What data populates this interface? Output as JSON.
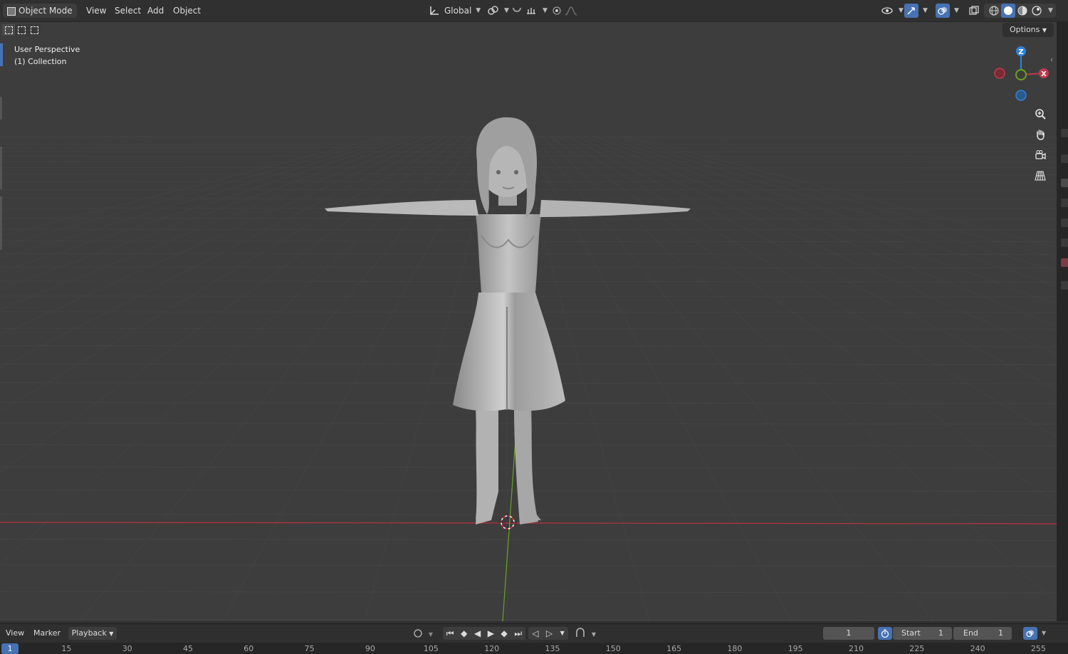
{
  "header": {
    "mode": "Object Mode",
    "menus": [
      "View",
      "Select",
      "Add",
      "Object"
    ],
    "orientation": "Global"
  },
  "viewport": {
    "view_name": "User Perspective",
    "collection": "(1) Collection",
    "options_label": "Options",
    "gizmo": {
      "z": "Z",
      "x": "X"
    }
  },
  "timeline": {
    "menus": [
      "View",
      "Marker"
    ],
    "playback": "Playback",
    "current_frame": "1",
    "start_label": "Start",
    "start_value": "1",
    "end_label": "End",
    "end_value": "1",
    "ruler_current": "1",
    "ruler_ticks": [
      "15",
      "30",
      "45",
      "60",
      "75",
      "90",
      "105",
      "120",
      "135",
      "150",
      "165",
      "180",
      "195",
      "210",
      "225",
      "240",
      "255"
    ]
  },
  "colors": {
    "accent": "#4772b3",
    "axis_x": "#c0394b",
    "axis_y": "#6aa321",
    "axis_z": "#2f82d7"
  },
  "icons": {
    "header": [
      "view-object-types-icon",
      "gizmo-icon",
      "overlays-icon",
      "xray-icon",
      "wireframe-shading-icon",
      "solid-shading-icon",
      "material-shading-icon",
      "rendered-shading-icon"
    ],
    "nav": [
      "zoom-icon",
      "hand-pan-icon",
      "camera-icon",
      "grid-perspective-icon"
    ]
  }
}
